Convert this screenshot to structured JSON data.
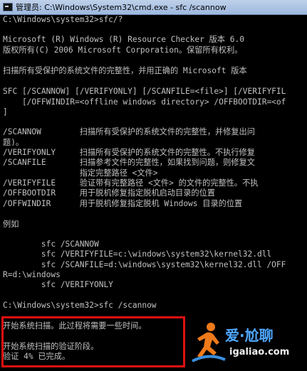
{
  "window": {
    "title": "管理员: C:\\Windows\\System32\\cmd.exe - sfc  /scannow",
    "icon": "cmd-icon"
  },
  "console": {
    "lines": [
      "C:\\Windows\\system32>sfc/?",
      "",
      "Microsoft (R) Windows (R) Resource Checker 版本 6.0",
      "版权所有(C) 2006 Microsoft Corporation。保留所有权利。",
      "",
      "扫描所有受保护的系统文件的完整性，并用正确的 Microsoft 版本",
      "",
      "SFC [/SCANNOW] [/VERIFYONLY] [/SCANFILE=<file>] [/VERIFYFIL",
      "    [/OFFWINDIR=<offline windows directory> /OFFBOOTDIR=<of",
      "]",
      "",
      "/SCANNOW        扫描所有受保护的系统文件的完整性，并修复出问",
      "题)。",
      "/VERIFYONLY     扫描所有受保护的系统文件的完整性。不执行修复",
      "/SCANFILE       扫描参考文件的完整性，如果找到问题，则修复文",
      "                指定完整路径 <文件>",
      "/VERIFYFILE     验证带有完整路径 <文件> 的文件的完整性。不执",
      "/OFFBOOTDIR     用于脱机修复指定脱机启动目录的位置",
      "/OFFWINDIR      用于脱机修复指定脱机 Windows 目录的位置",
      "",
      "例如",
      "",
      "        sfc /SCANNOW",
      "        sfc /VERIFYFILE=c:\\windows\\system32\\kernel32.dll",
      "        sfc /SCANFILE=d:\\windows\\system32\\kernel32.dll /OFF",
      "R=d:\\windows",
      "        sfc /VERIFYONLY",
      "",
      "C:\\Windows\\system32>sfc /scannow",
      "",
      "开始系统扫描。此过程将需要一些时间。",
      "",
      "开始系统扫描的验证阶段。",
      "验证 4% 已完成。"
    ],
    "line_offsets": [
      0,
      14,
      28,
      43,
      57,
      72,
      86,
      101,
      116,
      130,
      144,
      158,
      173,
      187,
      201,
      216,
      230,
      244,
      259,
      273,
      288,
      302,
      316,
      330,
      345,
      359,
      373,
      388,
      402,
      417,
      431,
      445,
      460,
      474
    ]
  },
  "watermark": {
    "text_cn": "爱·尬聊",
    "url": "igaliao.com"
  },
  "colors": {
    "console_bg": "#000000",
    "console_fg": "#c0c0c0",
    "highlight": "#e01010",
    "watermark_accent": "#4ea7ff",
    "watermark_figure": "#f07a1a"
  }
}
